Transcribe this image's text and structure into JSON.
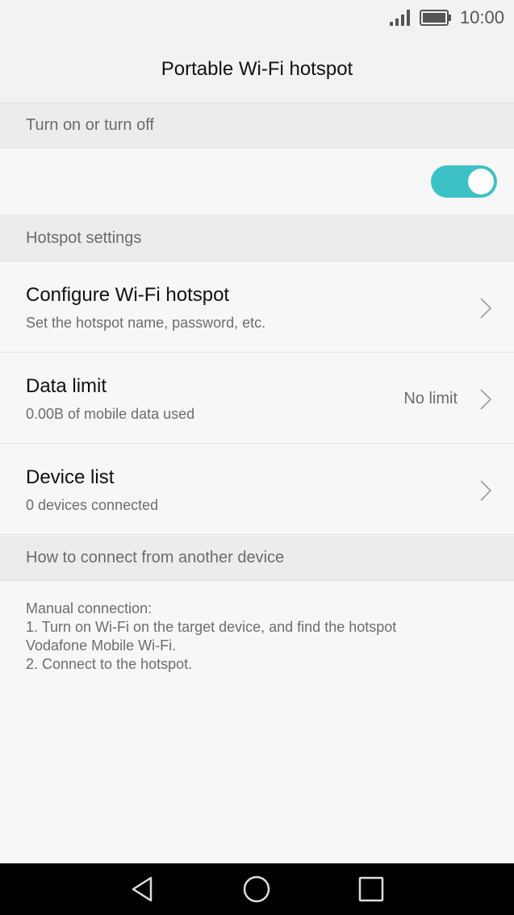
{
  "status_bar": {
    "time": "10:00",
    "icons": [
      "signal-icon",
      "battery-icon"
    ]
  },
  "header": {
    "title": "Portable Wi-Fi hotspot"
  },
  "sections": {
    "toggle_header": "Turn on or turn off",
    "hotspot_header": "Hotspot settings",
    "connect_header": "How to connect from another device"
  },
  "toggle": {
    "state": "on",
    "accent": "#3cc1c6"
  },
  "settings": [
    {
      "title": "Configure Wi-Fi hotspot",
      "subtitle": "Set the hotspot name, password, etc.",
      "value": ""
    },
    {
      "title": "Data limit",
      "subtitle": "0.00B of mobile data used",
      "value": "No limit"
    },
    {
      "title": "Device list",
      "subtitle": "0 devices connected",
      "value": ""
    }
  ],
  "instructions": {
    "lines": [
      "Manual connection:",
      "1. Turn on Wi-Fi on the target device, and find the hotspot",
      "Vodafone Mobile Wi-Fi.",
      "2. Connect to the hotspot."
    ]
  },
  "nav": {
    "icons": [
      "back-icon",
      "home-icon",
      "recents-icon"
    ]
  }
}
